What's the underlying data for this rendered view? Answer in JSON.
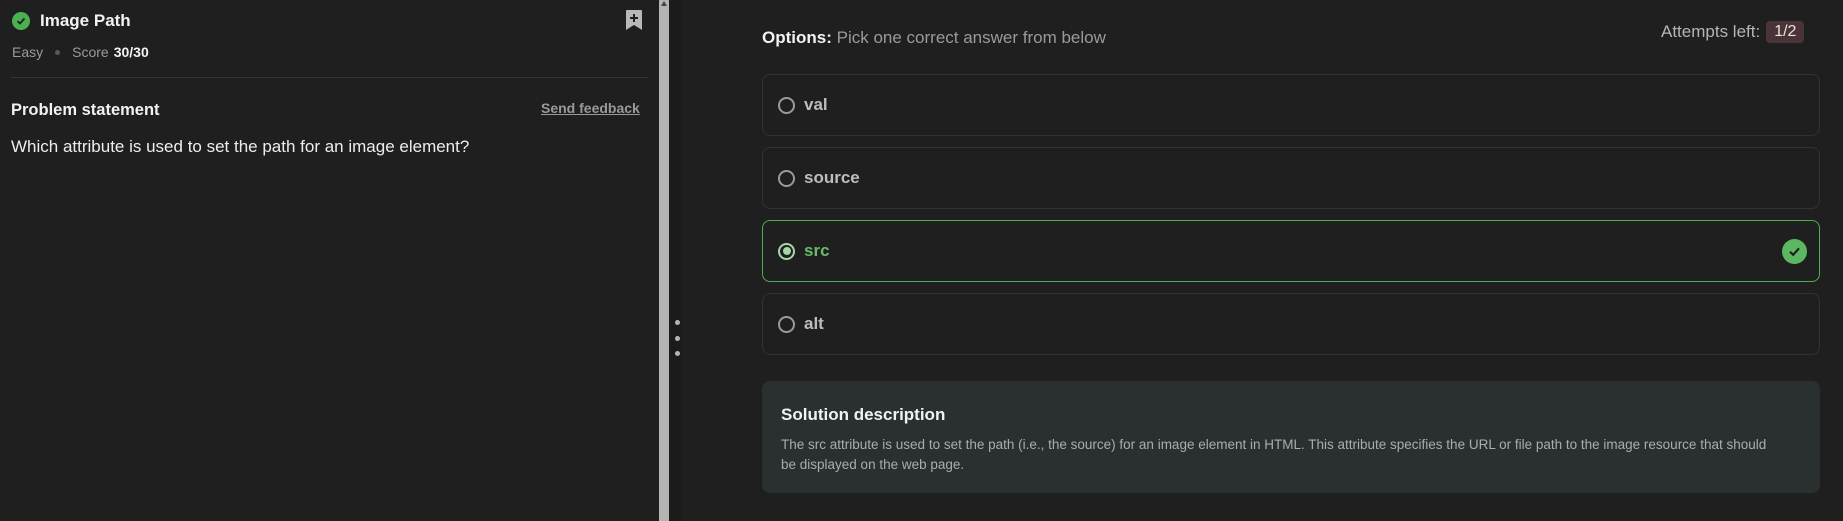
{
  "problem": {
    "title": "Image Path",
    "difficulty": "Easy",
    "score_label": "Score",
    "score_value": "30/30",
    "statement_label": "Problem statement",
    "feedback_link": "Send feedback",
    "question": "Which attribute is used to set the path for an image element?"
  },
  "options": {
    "label": "Options:",
    "instruction": "Pick one correct answer from below",
    "attempts_label": "Attempts left:",
    "attempts_value": "1/2",
    "items": [
      {
        "label": "val",
        "selected": false,
        "correct": false
      },
      {
        "label": "source",
        "selected": false,
        "correct": false
      },
      {
        "label": "src",
        "selected": true,
        "correct": true
      },
      {
        "label": "alt",
        "selected": false,
        "correct": false
      }
    ]
  },
  "solution": {
    "title": "Solution description",
    "text": "The src attribute is used to set the path (i.e., the source) for an image element in HTML. This attribute specifies the URL or file path to the image resource that should be displayed on the web page."
  },
  "colors": {
    "success": "#4caf50",
    "background": "#1f1f1f",
    "solution_bg": "#2a3030",
    "attempts_badge": "#4a3437"
  },
  "icons": [
    "check-circle-icon",
    "bookmark-add-icon",
    "radio-icon",
    "correct-check-icon",
    "splitter-grip-icon"
  ]
}
